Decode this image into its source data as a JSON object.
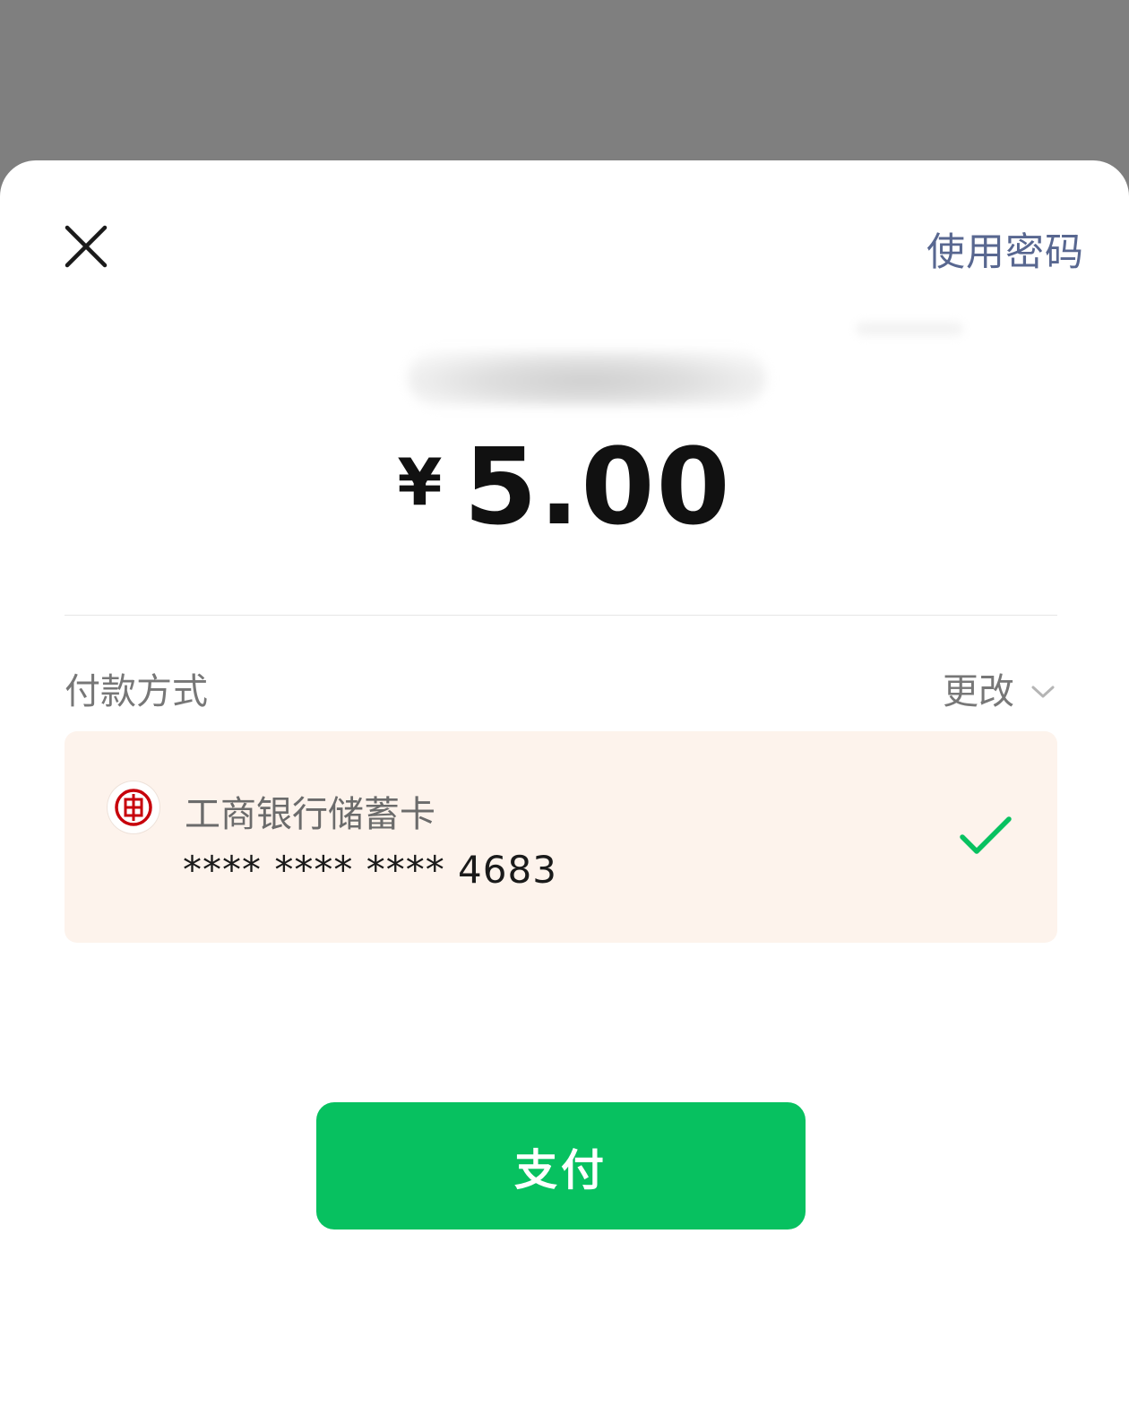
{
  "header": {
    "close_icon": "close-icon",
    "use_password": "使用密码"
  },
  "payment": {
    "currency_symbol": "¥",
    "amount": "5.00"
  },
  "method": {
    "label": "付款方式",
    "change_label": "更改",
    "change_icon": "chevron-down-icon"
  },
  "card": {
    "bank_icon": "icbc-logo-icon",
    "bank_name": "工商银行储蓄卡",
    "number": "**** **** **** 4683",
    "selected": true,
    "selected_icon": "check-icon"
  },
  "actions": {
    "pay_label": "支付"
  },
  "colors": {
    "overlay": "#7f7f7f",
    "accent_green": "#07c160",
    "link_blue": "#586790",
    "card_bg": "#fdf3ec",
    "icbc_red": "#c7000b"
  }
}
